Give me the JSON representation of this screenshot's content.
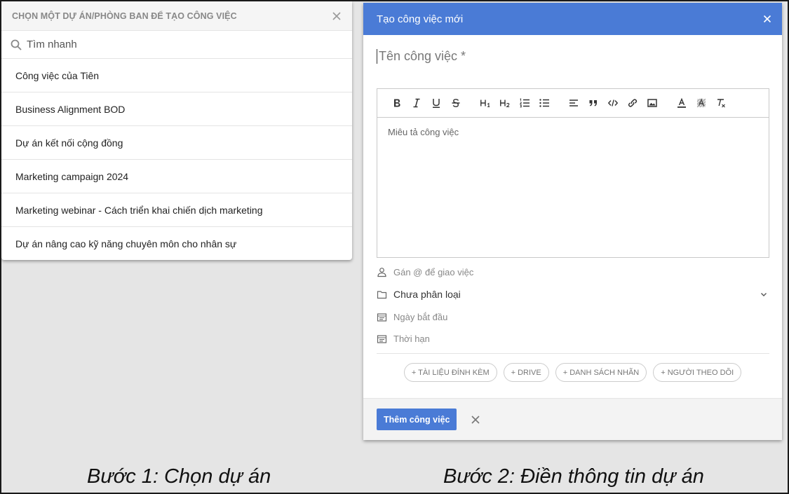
{
  "colors": {
    "accent": "#4a7bd6",
    "background": "#e5e5e5",
    "panel": "#ffffff",
    "muted_text": "#888888"
  },
  "project_picker": {
    "title": "CHỌN MỘT DỰ ÁN/PHÒNG BAN ĐỂ TẠO CÔNG VIỆC",
    "close_icon": "close-icon",
    "search": {
      "icon": "search-icon",
      "placeholder": "Tìm nhanh",
      "value": ""
    },
    "items": [
      {
        "label": "Công việc của Tiên"
      },
      {
        "label": "Business Alignment BOD"
      },
      {
        "label": "Dự án kết nối cộng đồng"
      },
      {
        "label": "Marketing campaign 2024"
      },
      {
        "label": "Marketing webinar - Cách triển khai chiến dịch marketing"
      },
      {
        "label": "Dự án nâng cao kỹ năng chuyên môn cho nhân sự"
      }
    ]
  },
  "task_form": {
    "title": "Tạo công việc mới",
    "name_placeholder": "Tên công việc *",
    "toolbar": [
      "bold-icon",
      "italic-icon",
      "underline-icon",
      "strikethrough-icon",
      "heading-1-icon",
      "heading-2-icon",
      "ordered-list-icon",
      "bullet-list-icon",
      "align-left-icon",
      "blockquote-icon",
      "code-icon",
      "link-icon",
      "image-icon",
      "text-color-icon",
      "highlight-icon",
      "clear-format-icon"
    ],
    "description_placeholder": "Miêu tả công việc",
    "assign_label": "Gán @ để giao việc",
    "category_value": "Chưa phân loại",
    "start_date_label": "Ngày bắt đầu",
    "deadline_label": "Thời hạn",
    "chips": [
      {
        "label": "+ TÀI LIỆU ĐÍNH KÈM"
      },
      {
        "label": "+ DRIVE"
      },
      {
        "label": "+ DANH SÁCH NHÃN"
      },
      {
        "label": "+ NGƯỜI THEO DÕI"
      }
    ],
    "submit_label": "Thêm công việc"
  },
  "captions": {
    "step1": "Bước 1: Chọn dự án",
    "step2": "Bước 2: Điền thông tin dự án"
  }
}
